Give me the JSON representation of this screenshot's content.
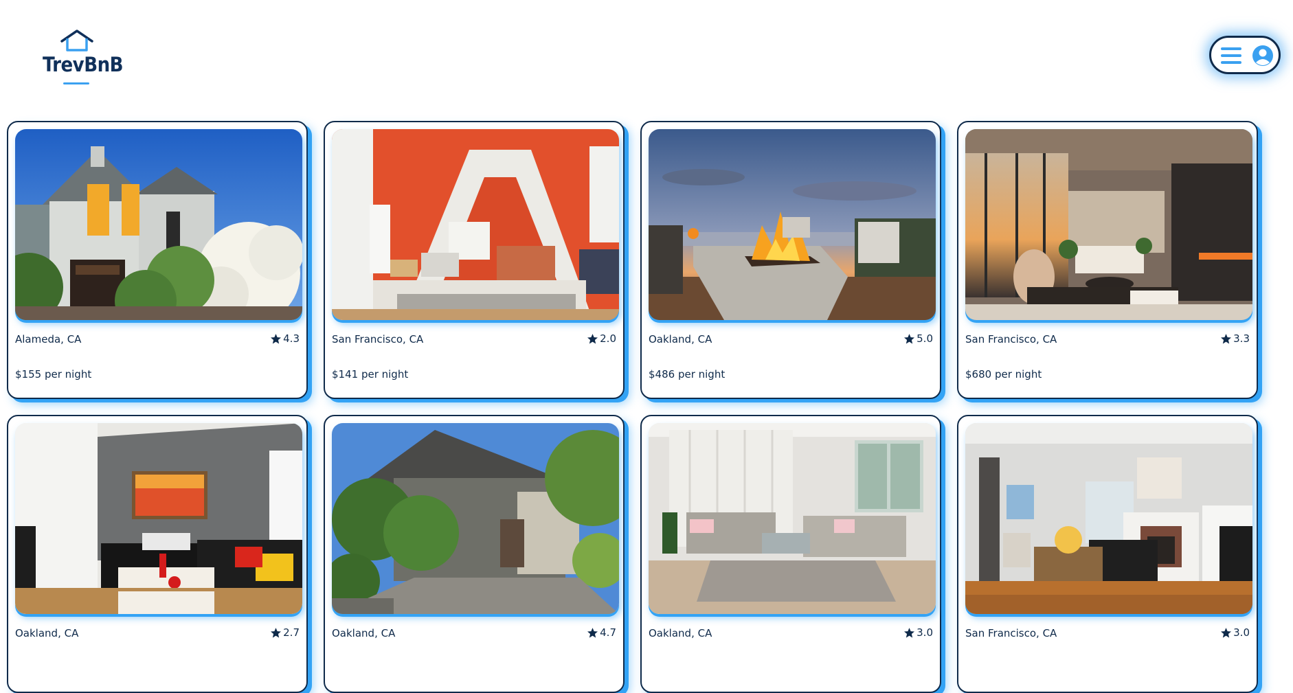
{
  "app": {
    "logo_text": "TrevBnB"
  },
  "header": {
    "menu_icon": "hamburger-menu-icon",
    "user_icon": "user-avatar-icon"
  },
  "colors": {
    "navy": "#0f2a4a",
    "accent_blue": "#33a3f5",
    "background": "#ffffff"
  },
  "listings": [
    {
      "location": "Alameda, CA",
      "rating": "4.3",
      "price": "$155 per night",
      "photo": "victorian-house-exterior"
    },
    {
      "location": "San Francisco, CA",
      "rating": "2.0",
      "price": "$141 per night",
      "photo": "orange-attic-living-room"
    },
    {
      "location": "Oakland, CA",
      "rating": "5.0",
      "price": "$486 per night",
      "photo": "deck-fire-pit-sunset"
    },
    {
      "location": "San Francisco, CA",
      "rating": "3.3",
      "price": "$680 per night",
      "photo": "modern-living-room-sunset-view"
    },
    {
      "location": "Oakland, CA",
      "rating": "2.7",
      "price": "",
      "photo": "black-leather-sofa-living-room"
    },
    {
      "location": "Oakland, CA",
      "rating": "4.7",
      "price": "",
      "photo": "craftsman-house-garden"
    },
    {
      "location": "Oakland, CA",
      "rating": "3.0",
      "price": "",
      "photo": "grey-sofa-living-room"
    },
    {
      "location": "San Francisco, CA",
      "rating": "3.0",
      "price": "",
      "photo": "fireplace-living-room"
    }
  ]
}
